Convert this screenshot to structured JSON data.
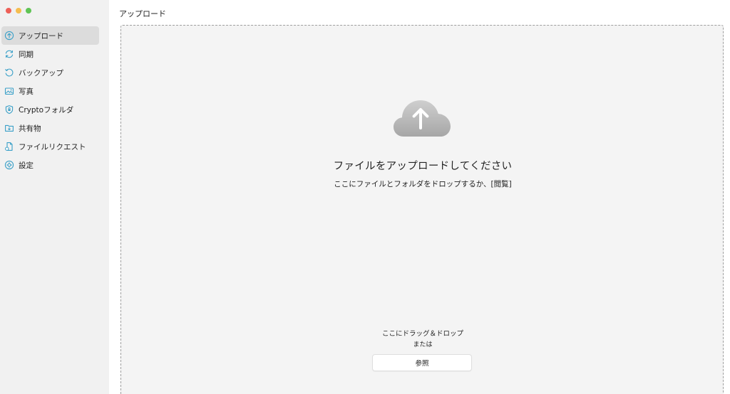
{
  "window": {
    "traffic_lights": [
      "close",
      "minimize",
      "zoom"
    ]
  },
  "sidebar": {
    "items": [
      {
        "label": "アップロード",
        "icon": "upload-icon",
        "active": true
      },
      {
        "label": "同期",
        "icon": "sync-icon",
        "active": false
      },
      {
        "label": "バックアップ",
        "icon": "backup-icon",
        "active": false
      },
      {
        "label": "写真",
        "icon": "photo-icon",
        "active": false
      },
      {
        "label": "Cryptoフォルダ",
        "icon": "shield-icon",
        "active": false
      },
      {
        "label": "共有物",
        "icon": "shared-icon",
        "active": false
      },
      {
        "label": "ファイルリクエスト",
        "icon": "file-request-icon",
        "active": false
      },
      {
        "label": "設定",
        "icon": "settings-icon",
        "active": false
      }
    ]
  },
  "main": {
    "title": "アップロード",
    "dropzone": {
      "headline": "ファイルをアップロードしてください",
      "subline": "ここにファイルとフォルダをドロップするか、[閲覧]",
      "drag_text": "ここにドラッグ＆ドロップ",
      "or_text": "または",
      "browse_label": "参照"
    }
  },
  "colors": {
    "accent": "#3aa0c8",
    "sidebar_bg": "#f1f1f1",
    "active_item_bg": "#dcdcdc",
    "dropzone_bg": "#f4f4f4"
  }
}
